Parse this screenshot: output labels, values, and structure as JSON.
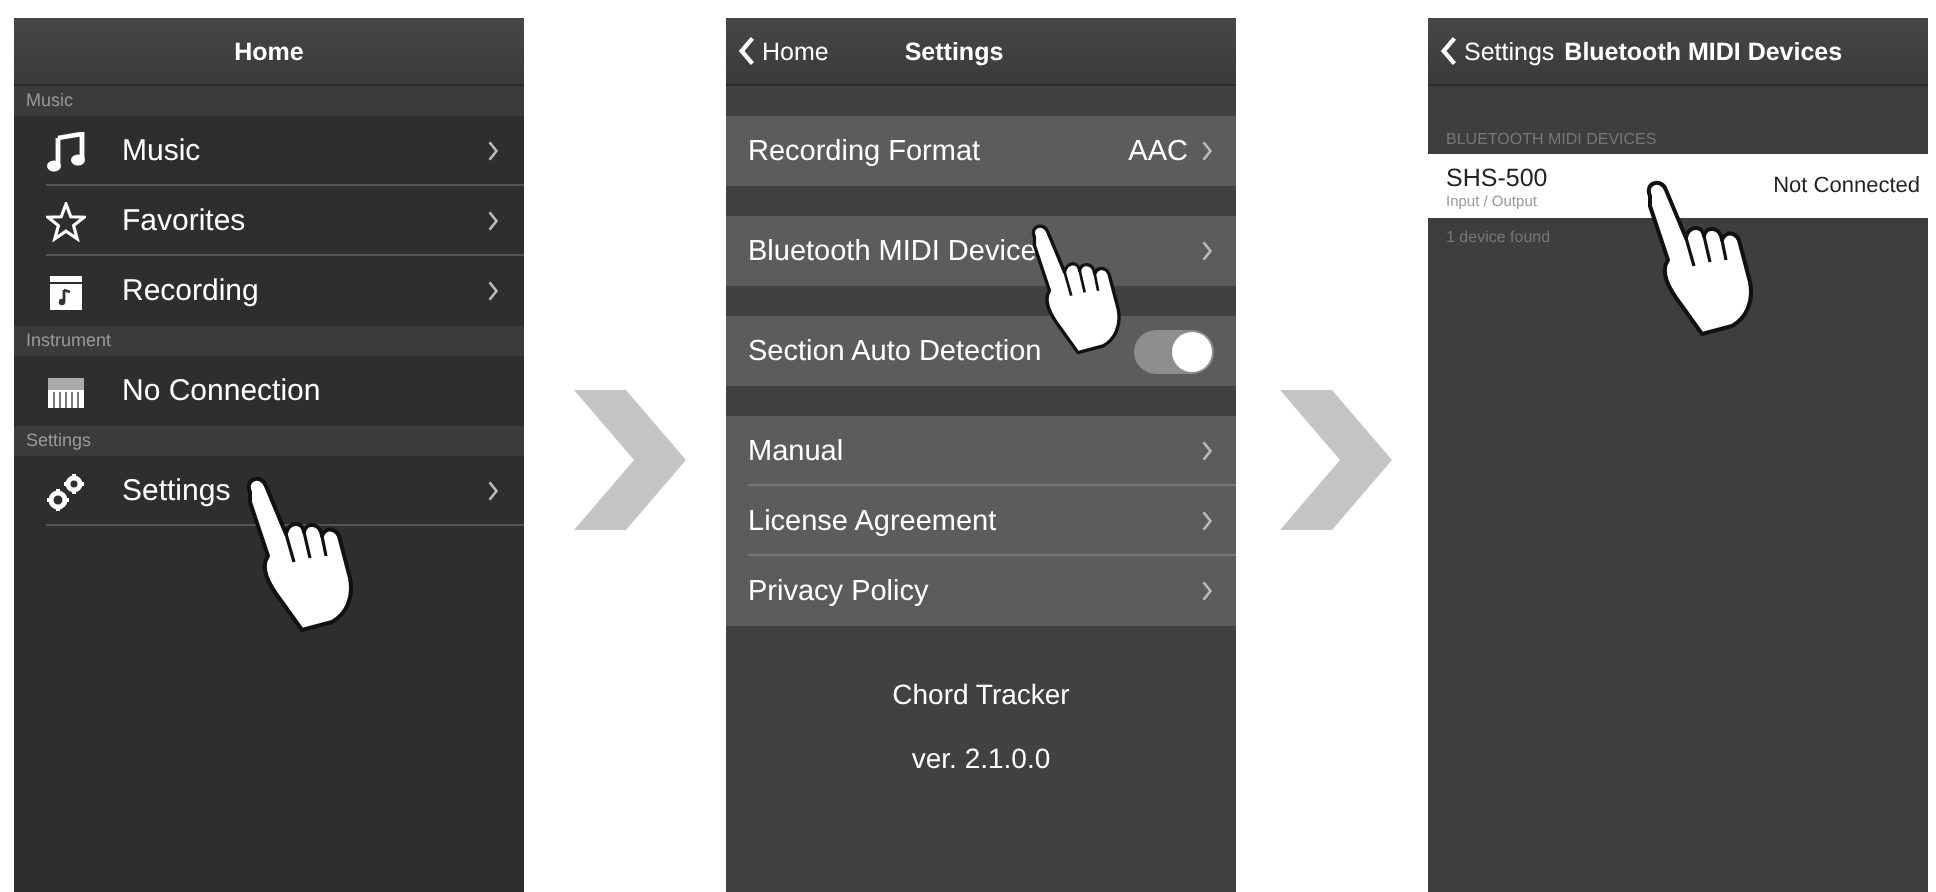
{
  "home_screen": {
    "title": "Home",
    "sections": [
      {
        "header": "Music",
        "items": [
          {
            "label": "Music",
            "chevron": true
          },
          {
            "label": "Favorites",
            "chevron": true
          },
          {
            "label": "Recording",
            "chevron": true
          }
        ]
      },
      {
        "header": "Instrument",
        "items": [
          {
            "label": "No Connection",
            "chevron": false
          }
        ]
      },
      {
        "header": "Settings",
        "items": [
          {
            "label": "Settings",
            "chevron": true
          }
        ]
      }
    ]
  },
  "settings_screen": {
    "back_label": "Home",
    "title": "Settings",
    "groups": [
      {
        "items": [
          {
            "kind": "link",
            "label": "Recording Format",
            "value": "AAC"
          }
        ]
      },
      {
        "items": [
          {
            "kind": "link",
            "label": "Bluetooth MIDI Device"
          }
        ]
      },
      {
        "items": [
          {
            "kind": "toggle",
            "label": "Section Auto Detection",
            "on": true
          }
        ]
      },
      {
        "items": [
          {
            "kind": "link",
            "label": "Manual"
          },
          {
            "kind": "link",
            "label": "License Agreement"
          },
          {
            "kind": "link",
            "label": "Privacy Policy"
          }
        ]
      }
    ],
    "app_name": "Chord Tracker",
    "version": "ver. 2.1.0.0"
  },
  "devices_screen": {
    "back_label": "Settings",
    "title": "Bluetooth MIDI Devices",
    "section_header": "BLUETOOTH MIDI DEVICES",
    "devices": [
      {
        "name": "SHS-500",
        "subtitle": "Input / Output",
        "status": "Not Connected"
      }
    ],
    "footer": "1 device found"
  }
}
